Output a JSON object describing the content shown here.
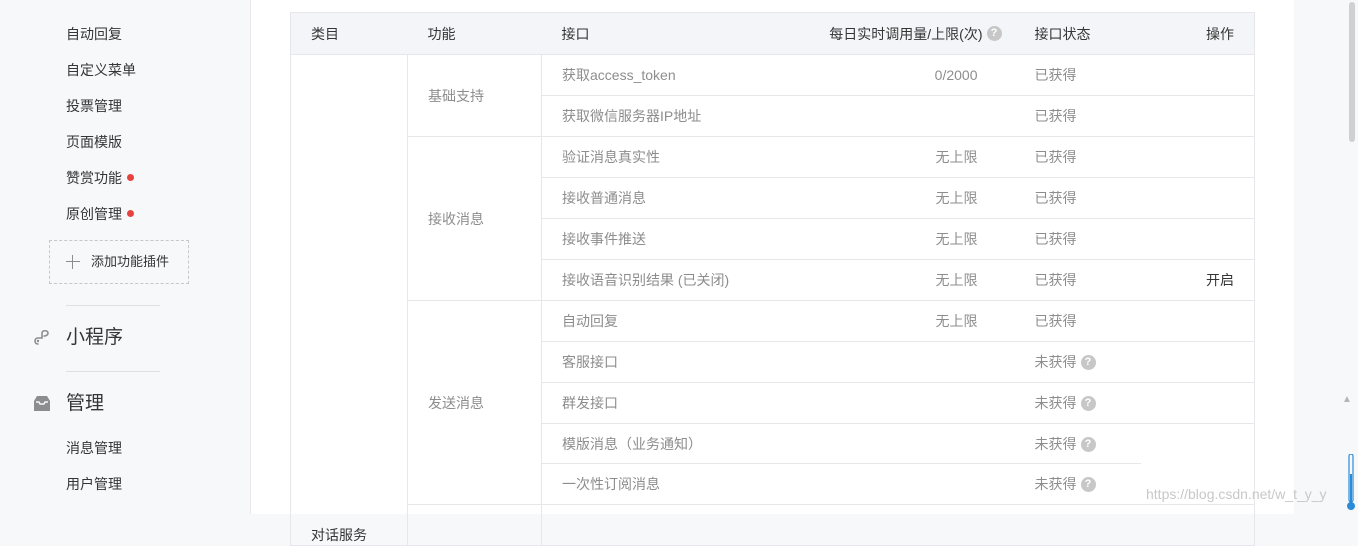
{
  "sidebar": {
    "items": [
      {
        "label": "自动回复"
      },
      {
        "label": "自定义菜单"
      },
      {
        "label": "投票管理"
      },
      {
        "label": "页面模版"
      },
      {
        "label": "赞赏功能"
      },
      {
        "label": "原创管理"
      }
    ],
    "add_plugin": "添加功能插件",
    "mini_program": "小程序",
    "manage": "管理",
    "manage_items": [
      {
        "label": "消息管理"
      },
      {
        "label": "用户管理"
      }
    ]
  },
  "table": {
    "headers": {
      "category": "类目",
      "function": "功能",
      "api": "接口",
      "quota": "每日实时调用量/上限(次)",
      "status": "接口状态",
      "action": "操作"
    },
    "category": "对话服务",
    "groups": [
      {
        "function": "基础支持"
      },
      {
        "function": "接收消息"
      },
      {
        "function": "发送消息"
      }
    ],
    "rows": [
      {
        "api": "获取access_token",
        "quota": "0/2000",
        "status": "已获得",
        "action": ""
      },
      {
        "api": "获取微信服务器IP地址",
        "quota": "",
        "status": "已获得",
        "action": ""
      },
      {
        "api": "验证消息真实性",
        "quota": "无上限",
        "status": "已获得",
        "action": ""
      },
      {
        "api": "接收普通消息",
        "quota": "无上限",
        "status": "已获得",
        "action": ""
      },
      {
        "api": "接收事件推送",
        "quota": "无上限",
        "status": "已获得",
        "action": ""
      },
      {
        "api": "接收语音识别结果 (已关闭)",
        "quota": "无上限",
        "status": "已获得",
        "action": "开启"
      },
      {
        "api": "自动回复",
        "quota": "无上限",
        "status": "已获得",
        "action": ""
      },
      {
        "api": "客服接口",
        "quota": "",
        "status": "未获得",
        "action": ""
      },
      {
        "api": "群发接口",
        "quota": "",
        "status": "未获得",
        "action": ""
      },
      {
        "api": "模版消息（业务通知）",
        "quota": "",
        "status": "未获得",
        "action": ""
      },
      {
        "api": "一次性订阅消息",
        "quota": "",
        "status": "未获得",
        "action": ""
      }
    ]
  },
  "help_glyph": "?",
  "watermark": "https://blog.csdn.net/w_t_y_y",
  "colors": {
    "accent_red": "#e64340",
    "border": "#e7e7eb",
    "header_bg": "#f4f5f9",
    "muted_text": "#8d8d8d"
  }
}
